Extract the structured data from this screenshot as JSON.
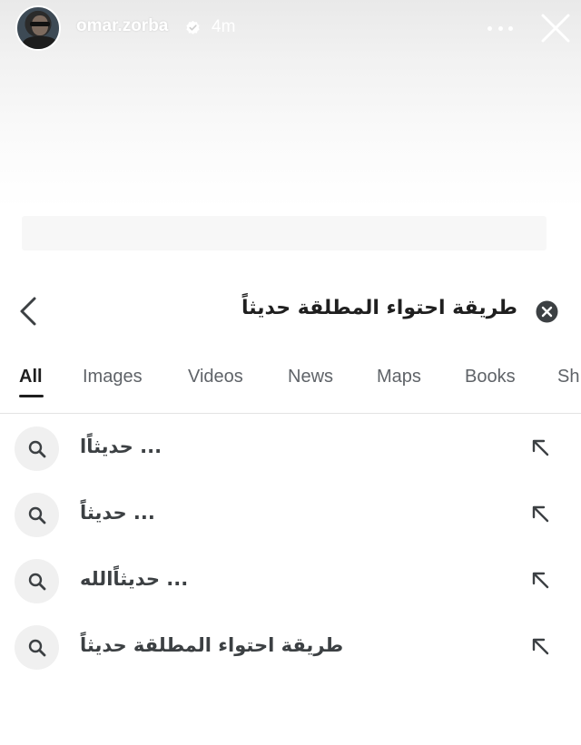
{
  "story": {
    "username": "omar.zorba",
    "time_ago": "4m"
  },
  "search": {
    "query": "طريقة احتواء المطلقة حديثاً"
  },
  "tabs": [
    {
      "label": "All",
      "active": true
    },
    {
      "label": "Images",
      "active": false
    },
    {
      "label": "Videos",
      "active": false
    },
    {
      "label": "News",
      "active": false
    },
    {
      "label": "Maps",
      "active": false
    },
    {
      "label": "Books",
      "active": false
    },
    {
      "label": "Sh",
      "active": false
    }
  ],
  "suggestions": [
    {
      "text": "... حديثاًا"
    },
    {
      "text": "... حديثاًَ"
    },
    {
      "text": "... حديثاًالله"
    },
    {
      "text": "طريقة احتواء المطلقة حديثاً"
    }
  ],
  "colors": {
    "header_text": "#ffffff",
    "query_text": "#1f1f1f",
    "tab_inactive": "#5f6368",
    "suggestion_text": "#3c4043",
    "icon_bg": "#f0f0f0"
  }
}
